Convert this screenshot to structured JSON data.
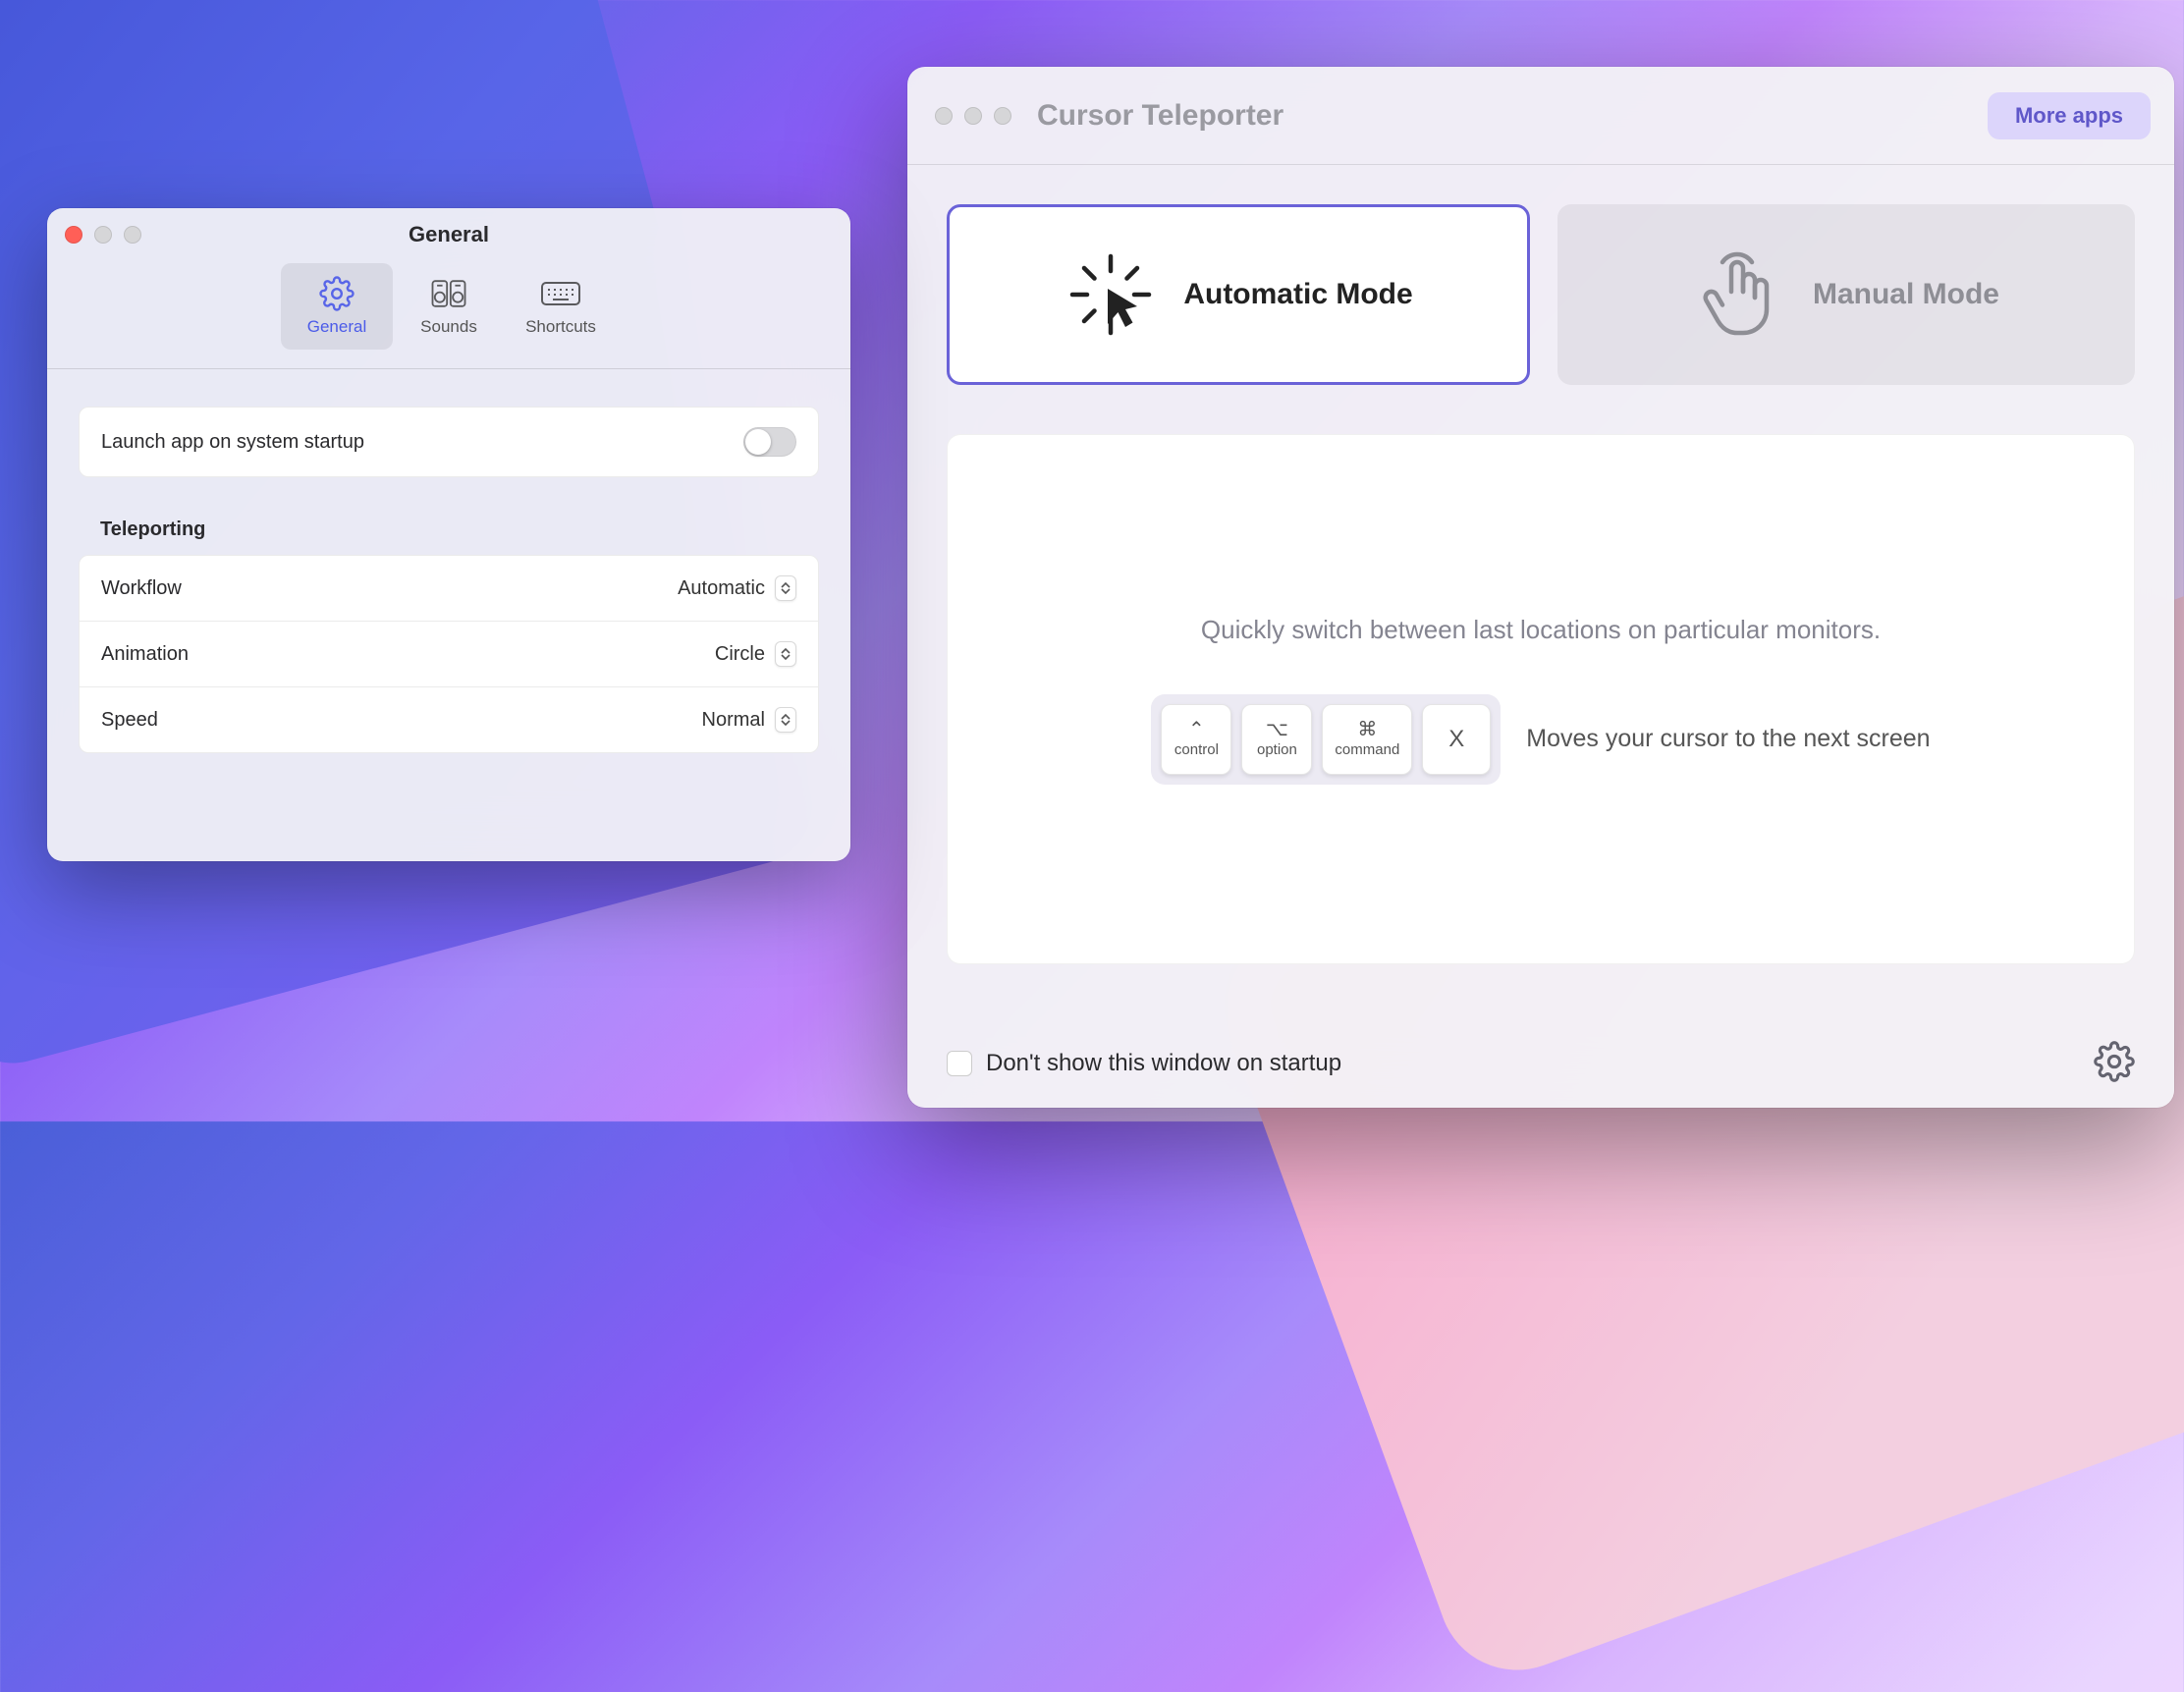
{
  "settings": {
    "title": "General",
    "tabs": [
      {
        "label": "General"
      },
      {
        "label": "Sounds"
      },
      {
        "label": "Shortcuts"
      }
    ],
    "launch_label": "Launch app on system startup",
    "launch_enabled": false,
    "section_title": "Teleporting",
    "rows": [
      {
        "label": "Workflow",
        "value": "Automatic"
      },
      {
        "label": "Animation",
        "value": "Circle"
      },
      {
        "label": "Speed",
        "value": "Normal"
      }
    ]
  },
  "main": {
    "title": "Cursor Teleporter",
    "more_apps": "More apps",
    "modes": {
      "auto": "Automatic Mode",
      "manual": "Manual Mode"
    },
    "info_text": "Quickly switch between last locations on particular monitors.",
    "shortcut": {
      "keys": [
        {
          "symbol": "⌃",
          "label": "control"
        },
        {
          "symbol": "⌥",
          "label": "option"
        },
        {
          "symbol": "⌘",
          "label": "command"
        },
        {
          "symbol": "X",
          "label": ""
        }
      ],
      "description": "Moves your cursor to the next screen"
    },
    "footer": {
      "dont_show": "Don't show this window on startup"
    }
  }
}
